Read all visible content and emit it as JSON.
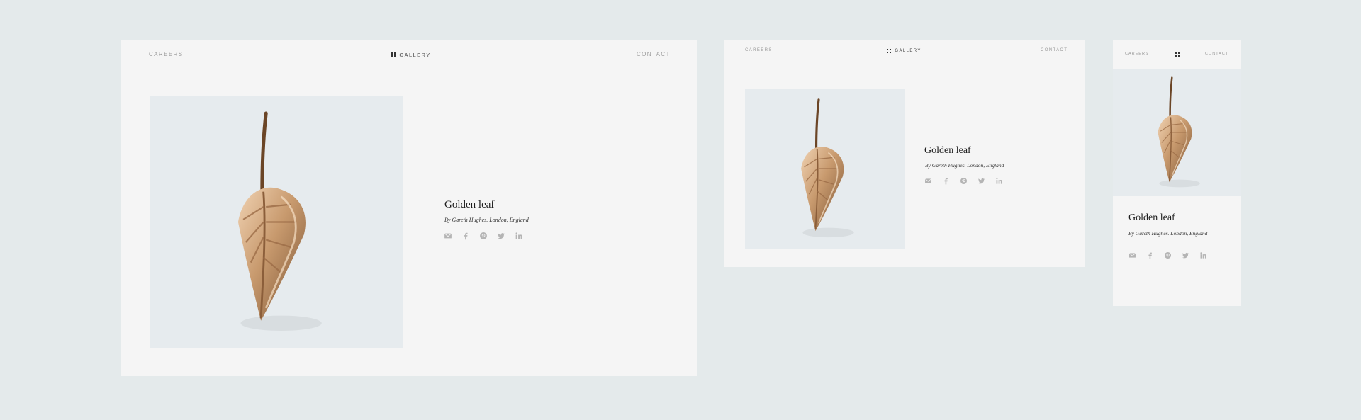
{
  "nav": {
    "careers": "CAREERS",
    "gallery": "GALLERY",
    "contact": "CONTACT"
  },
  "artwork": {
    "title": "Golden leaf",
    "byline": "By Gareth Hughes. London, England"
  },
  "social_icons": [
    "mail-icon",
    "facebook-icon",
    "pinterest-icon",
    "twitter-icon",
    "linkedin-icon"
  ],
  "colors": {
    "background": "#e4eaeb",
    "card": "#f5f5f5",
    "photo_bg": "#e6ebee",
    "leaf": "#c89a6e",
    "icon": "#b4b4b4"
  }
}
